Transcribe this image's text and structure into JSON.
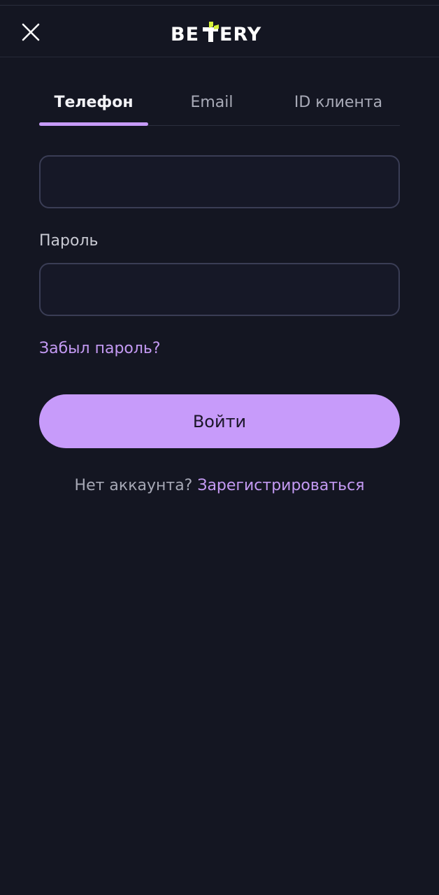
{
  "header": {
    "logo_text": "BETERY",
    "close_icon": "close-icon",
    "logo_accent_color": "#d6f23a"
  },
  "tabs": [
    {
      "label": "Телефон",
      "active": true
    },
    {
      "label": "Email",
      "active": false
    },
    {
      "label": "ID клиента",
      "active": false
    }
  ],
  "form": {
    "phone_value": "",
    "password_label": "Пароль",
    "password_value": "",
    "forgot_label": "Забыл пароль?",
    "login_label": "Войти"
  },
  "signup": {
    "question": "Нет аккаунта?",
    "link": "Зарегистрироваться"
  },
  "colors": {
    "background": "#141622",
    "accent": "#c79bfa",
    "link": "#c49af3"
  }
}
